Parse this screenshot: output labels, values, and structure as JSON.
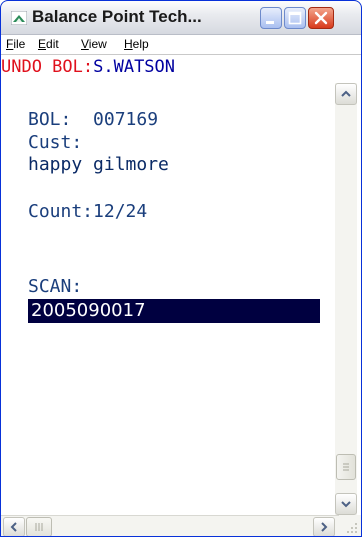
{
  "window": {
    "title": "Balance Point Tech...",
    "app_icon": "balance-point-icon",
    "controls": [
      "minimize-icon",
      "maximize-icon",
      "close-icon"
    ]
  },
  "menu": {
    "items": [
      {
        "label": "File",
        "accel": "F",
        "rest": "ile"
      },
      {
        "label": "Edit",
        "accel": "E",
        "rest": "dit"
      },
      {
        "label": "View",
        "accel": "V",
        "rest": "iew"
      },
      {
        "label": "Help",
        "accel": "H",
        "rest": "elp"
      }
    ]
  },
  "screen": {
    "header_prefix": "UNDO BOL:",
    "operator": "S.WATSON",
    "bol_label": "BOL:",
    "bol_value": "007169",
    "cust_label": "Cust:",
    "cust_value": "happy gilmore",
    "count_label": "Count:",
    "count_value": "12/24",
    "scan_label": "SCAN:",
    "scan_value": "2005090017"
  },
  "colors": {
    "header": "#e0101c",
    "content": "#1a3e7c",
    "scan_highlight": "#000040"
  }
}
